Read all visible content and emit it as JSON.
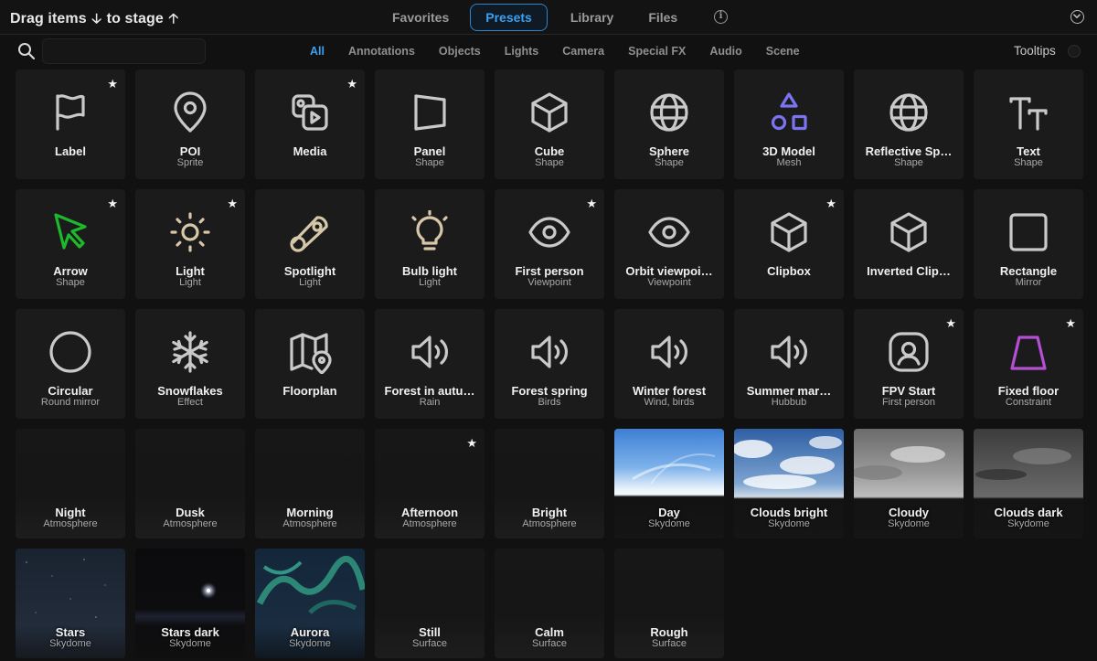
{
  "header": {
    "drag_label_a": "Drag items",
    "drag_label_b": "to stage",
    "tabs": [
      "Favorites",
      "Presets",
      "Library",
      "Files"
    ],
    "active_tab": "Presets"
  },
  "toolbar": {
    "search_placeholder": "",
    "search_value": "",
    "filters": [
      "All",
      "Annotations",
      "Objects",
      "Lights",
      "Camera",
      "Special FX",
      "Audio",
      "Scene"
    ],
    "active_filter": "All",
    "tooltips_label": "Tooltips",
    "tooltips_on": false
  },
  "colors": {
    "accent": "#3aa0f0",
    "arrow_green": "#1db82b",
    "model_purple": "#7b74f0",
    "floor_purple": "#b44fd3",
    "light_beige": "#d6c7a8"
  },
  "items": [
    {
      "name": "Label",
      "sub": "",
      "icon": "flag-icon",
      "star": true
    },
    {
      "name": "POI",
      "sub": "Sprite",
      "icon": "map-pin-icon",
      "star": false
    },
    {
      "name": "Media",
      "sub": "",
      "icon": "media-icon",
      "star": true
    },
    {
      "name": "Panel",
      "sub": "Shape",
      "icon": "panel-icon",
      "star": false
    },
    {
      "name": "Cube",
      "sub": "Shape",
      "icon": "cube-icon",
      "star": false
    },
    {
      "name": "Sphere",
      "sub": "Shape",
      "icon": "globe-icon",
      "star": false
    },
    {
      "name": "3D Model",
      "sub": "Mesh",
      "icon": "shapes-icon",
      "star": false
    },
    {
      "name": "Reflective Sp…",
      "sub": "Shape",
      "icon": "globe-icon",
      "star": false
    },
    {
      "name": "Text",
      "sub": "Shape",
      "icon": "text-icon",
      "star": false
    },
    {
      "name": "Arrow",
      "sub": "Shape",
      "icon": "pointer-arrow-icon",
      "star": true
    },
    {
      "name": "Light",
      "sub": "Light",
      "icon": "sun-icon",
      "star": true
    },
    {
      "name": "Spotlight",
      "sub": "Light",
      "icon": "spotlight-icon",
      "star": false
    },
    {
      "name": "Bulb light",
      "sub": "Light",
      "icon": "bulb-icon",
      "star": false
    },
    {
      "name": "First person",
      "sub": "Viewpoint",
      "icon": "eye-icon",
      "star": true
    },
    {
      "name": "Orbit viewpoi…",
      "sub": "Viewpoint",
      "icon": "eye-icon",
      "star": false
    },
    {
      "name": "Clipbox",
      "sub": "",
      "icon": "cube-icon",
      "star": true
    },
    {
      "name": "Inverted Clip…",
      "sub": "",
      "icon": "cube-icon",
      "star": false
    },
    {
      "name": "Rectangle",
      "sub": "Mirror",
      "icon": "square-icon",
      "star": false
    },
    {
      "name": "Circular",
      "sub": "Round mirror",
      "icon": "circle-icon",
      "star": false
    },
    {
      "name": "Snowflakes",
      "sub": "Effect",
      "icon": "snowflake-icon",
      "star": false
    },
    {
      "name": "Floorplan",
      "sub": "",
      "icon": "map-icon",
      "star": false
    },
    {
      "name": "Forest in autu…",
      "sub": "Rain",
      "icon": "speaker-icon",
      "star": false
    },
    {
      "name": "Forest spring",
      "sub": "Birds",
      "icon": "speaker-icon",
      "star": false
    },
    {
      "name": "Winter forest",
      "sub": "Wind, birds",
      "icon": "speaker-icon",
      "star": false
    },
    {
      "name": "Summer mar…",
      "sub": "Hubbub",
      "icon": "speaker-icon",
      "star": false
    },
    {
      "name": "FPV Start",
      "sub": "First person",
      "icon": "user-square-icon",
      "star": true
    },
    {
      "name": "Fixed floor",
      "sub": "Constraint",
      "icon": "trapezoid-icon",
      "star": true
    },
    {
      "name": "Night",
      "sub": "Atmosphere",
      "icon": "",
      "star": false
    },
    {
      "name": "Dusk",
      "sub": "Atmosphere",
      "icon": "",
      "star": false
    },
    {
      "name": "Morning",
      "sub": "Atmosphere",
      "icon": "",
      "star": false
    },
    {
      "name": "Afternoon",
      "sub": "Atmosphere",
      "icon": "",
      "star": true
    },
    {
      "name": "Bright",
      "sub": "Atmosphere",
      "icon": "",
      "star": false
    },
    {
      "name": "Day",
      "sub": "Skydome",
      "icon": "sky-day-thumb",
      "star": false
    },
    {
      "name": "Clouds bright",
      "sub": "Skydome",
      "icon": "sky-clouds-bright-thumb",
      "star": false
    },
    {
      "name": "Cloudy",
      "sub": "Skydome",
      "icon": "sky-cloudy-thumb",
      "star": false
    },
    {
      "name": "Clouds dark",
      "sub": "Skydome",
      "icon": "sky-clouds-dark-thumb",
      "star": false
    },
    {
      "name": "Stars",
      "sub": "Skydome",
      "icon": "sky-stars-thumb",
      "star": false
    },
    {
      "name": "Stars dark",
      "sub": "Skydome",
      "icon": "sky-stars-dark-thumb",
      "star": false
    },
    {
      "name": "Aurora",
      "sub": "Skydome",
      "icon": "sky-aurora-thumb",
      "star": false
    },
    {
      "name": "Still",
      "sub": "Surface",
      "icon": "",
      "star": false
    },
    {
      "name": "Calm",
      "sub": "Surface",
      "icon": "",
      "star": false
    },
    {
      "name": "Rough",
      "sub": "Surface",
      "icon": "",
      "star": false
    }
  ]
}
